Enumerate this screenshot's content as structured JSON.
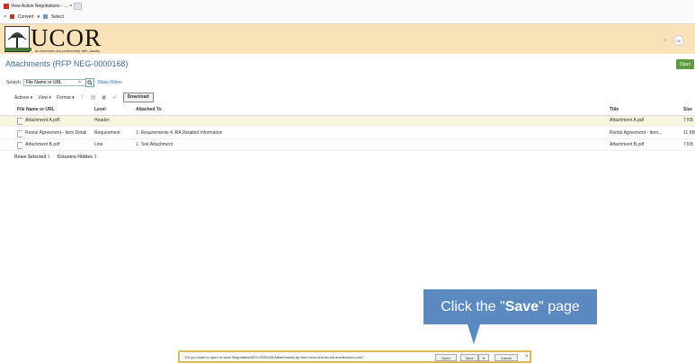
{
  "browser": {
    "tab_title": "View Active Negotiations - ...",
    "tab_close": "×",
    "command_label": "Convert",
    "select_label": "Select"
  },
  "banner": {
    "logo_word": "UCOR",
    "logo_tagline": "an Amentum-led partnership with Jacobs",
    "user_initials": "DE",
    "user_chevron": "»"
  },
  "page": {
    "title": "Attachments (RFP NEG-0000168)",
    "open_button": "Open"
  },
  "search": {
    "label": "Search",
    "placeholder": "File Name or URL",
    "value": "File Name or URL",
    "clear": "×",
    "show_filters": "Show Filters"
  },
  "toolbar": {
    "actions": "Actions ▾",
    "view": "View ▾",
    "format": "Format ▾",
    "download": "Download"
  },
  "table": {
    "columns": {
      "file": "File Name or URL",
      "level": "Level",
      "attached_to": "Attached To",
      "title": "Title",
      "size": "Size"
    },
    "rows": [
      {
        "file": "Attachment A.pdf",
        "level": "Header",
        "attached_to": "",
        "title": "Attachment A.pdf",
        "size": "7 KB"
      },
      {
        "file": "Rental Agreement - Item Detail...",
        "level": "Requirement",
        "attached_to": "1. Requirements 4. RA Detailed Information",
        "title": "Rental Agreement - Item...",
        "size": "11 KB"
      },
      {
        "file": "Attachment B.pdf",
        "level": "Line",
        "attached_to": "1. Test Attachment",
        "title": "Attachment B.pdf",
        "size": "7 KB"
      }
    ]
  },
  "status": {
    "rows_selected_label": "Rows Selected",
    "rows_selected_value": "1",
    "columns_hidden_label": "Columns Hidden",
    "columns_hidden_value": "3"
  },
  "callout": {
    "prefix": "Click the \"",
    "bold": "Save",
    "suffix": "\" page"
  },
  "download_bar": {
    "message": "Do you want to open or save NegotiationNEG-0000168-Attachments.zip from ecsx-test.fa.us6.oraclecloud.com?",
    "open": "Open",
    "save": "Save",
    "arrow": "▾",
    "cancel": "Cancel",
    "close": "×"
  },
  "colors": {
    "banner": "#fae3b8",
    "title": "#3d6b8a",
    "open_button": "#5f9a3f",
    "callout": "#5a8ac0",
    "download_bar_border": "#e0b95c"
  }
}
